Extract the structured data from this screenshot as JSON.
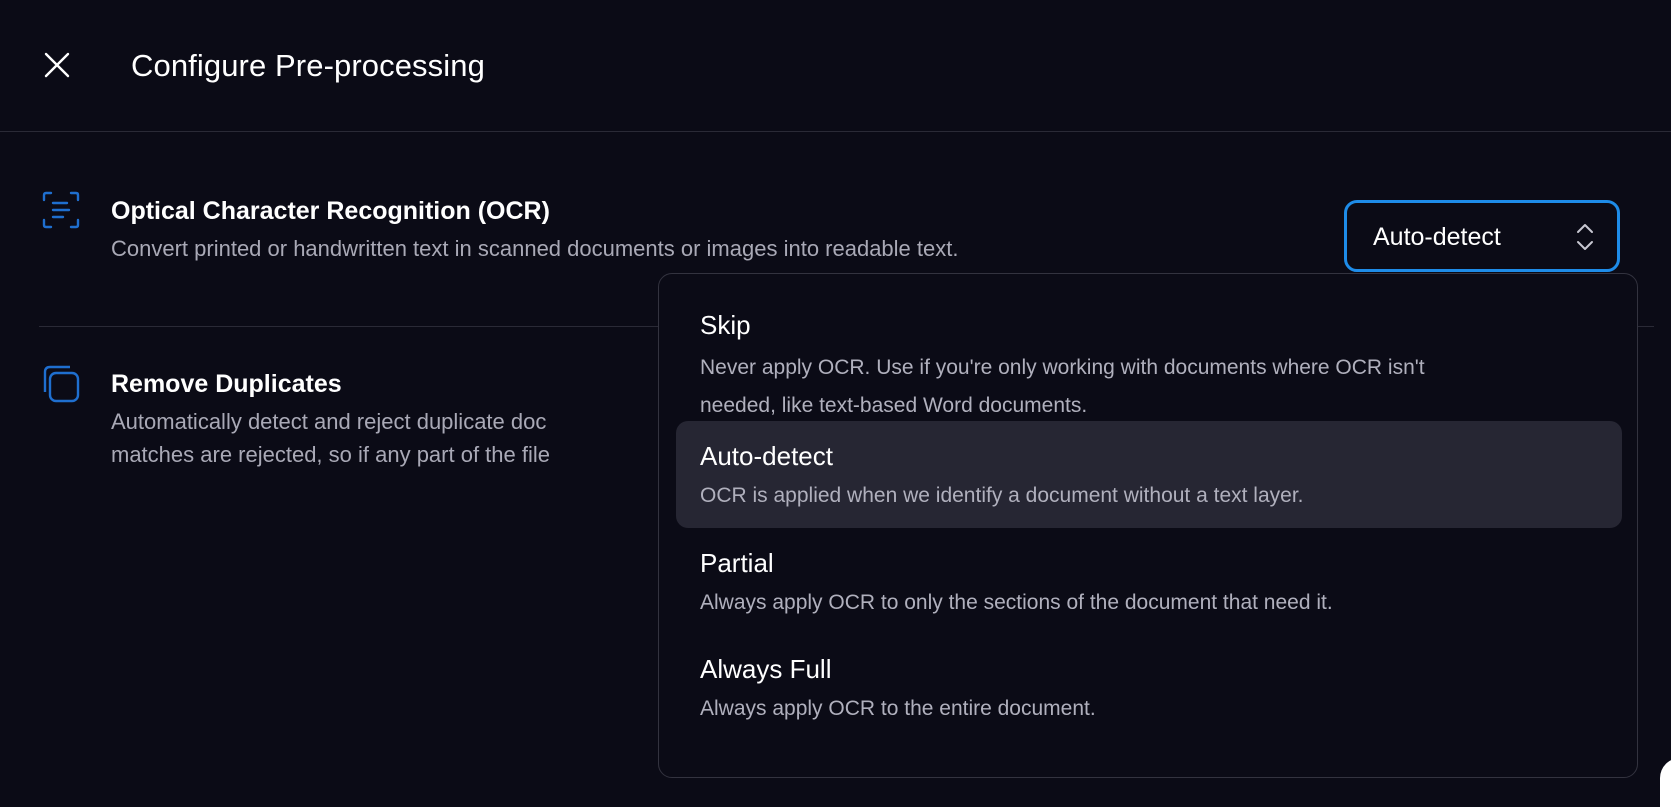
{
  "header": {
    "title": "Configure Pre-processing",
    "close_icon": "close-icon"
  },
  "settings": {
    "ocr": {
      "icon": "document-text-scan-icon",
      "title": "Optical Character Recognition (OCR)",
      "description": "Convert printed or handwritten text in scanned documents or images into readable text."
    },
    "duplicates": {
      "icon": "copy-icon",
      "title": "Remove Duplicates",
      "description_line1": "Automatically detect and reject duplicate doc",
      "description_line2": "matches are rejected, so if any part of the file"
    }
  },
  "select": {
    "value": "Auto-detect",
    "icon": "chevron-up-down-icon"
  },
  "dropdown": {
    "options": [
      {
        "label": "Skip",
        "description_line1": "Never apply OCR. Use if you're only working with documents where OCR isn't",
        "description_line2": "needed, like text-based Word documents.",
        "selected": false
      },
      {
        "label": "Auto-detect",
        "description_line1": "OCR is applied when we identify a document without a text layer.",
        "selected": true
      },
      {
        "label": "Partial",
        "description_line1": "Always apply OCR to only the sections of the document that need it.",
        "selected": false
      },
      {
        "label": "Always Full",
        "description_line1": "Always apply OCR to the entire document.",
        "selected": false
      }
    ]
  },
  "colors": {
    "background": "#0b0b16",
    "accent": "#1e8ce8",
    "icon_blue": "#1f6fcf",
    "muted_text": "#a9a9b6",
    "selected_option_bg": "#262633"
  }
}
